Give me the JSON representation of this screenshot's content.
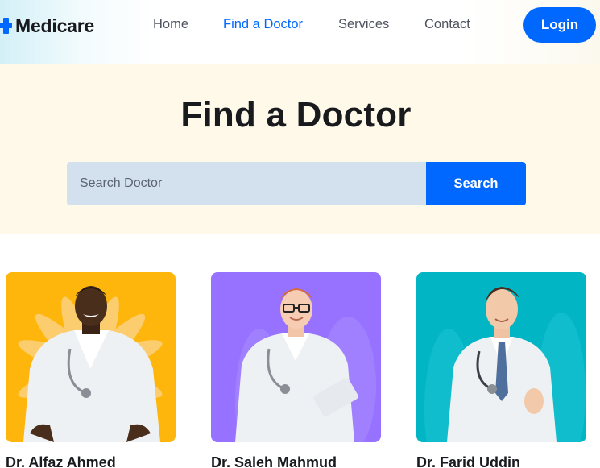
{
  "brand": {
    "name": "Medicare",
    "accent": "#0067ff"
  },
  "nav": {
    "items": [
      {
        "label": "Home",
        "active": false
      },
      {
        "label": "Find a Doctor",
        "active": true
      },
      {
        "label": "Services",
        "active": false
      },
      {
        "label": "Contact",
        "active": false
      }
    ],
    "login_label": "Login"
  },
  "hero": {
    "title": "Find a Doctor",
    "search_placeholder": "Search Doctor",
    "search_button": "Search"
  },
  "doctors": [
    {
      "name": "Dr. Alfaz Ahmed",
      "photo_bg": "#feb60d"
    },
    {
      "name": "Dr. Saleh Mahmud",
      "photo_bg": "#9771ff"
    },
    {
      "name": "Dr. Farid Uddin",
      "photo_bg": "#01b5c5"
    }
  ]
}
